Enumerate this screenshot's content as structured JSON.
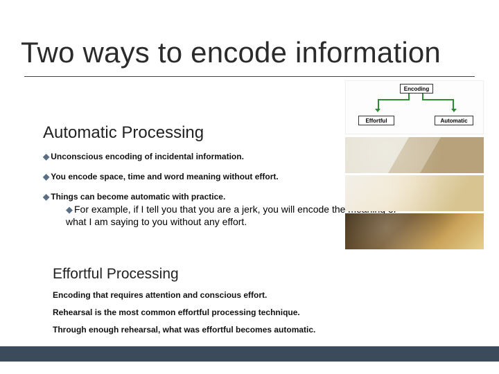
{
  "title": "Two ways to encode information",
  "diagram": {
    "top": "Encoding",
    "left": "Effortful",
    "right": "Automatic"
  },
  "automatic": {
    "heading": "Automatic Processing",
    "bullets": [
      "Unconscious encoding of incidental information.",
      "You encode space, time and word meaning without effort.",
      "Things can become automatic with practice."
    ],
    "sub_example": "For example, if I tell you that you are a jerk, you will encode the meaning of what I am saying to you without any effort."
  },
  "effortful": {
    "heading": "Effortful Processing",
    "lines": [
      "Encoding that requires attention and conscious effort.",
      "Rehearsal is the most common effortful processing technique.",
      "Through enough rehearsal, what was effortful becomes automatic."
    ]
  }
}
